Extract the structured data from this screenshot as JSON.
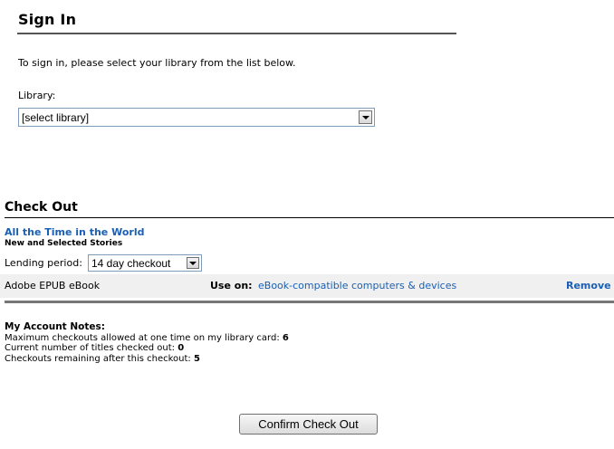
{
  "sign_in": {
    "title": "Sign In",
    "instructions": "To sign in, please select your library from the list below.",
    "library_label": "Library:",
    "library_select_value": "[select library]"
  },
  "checkout": {
    "title": "Check Out",
    "book_title": "All the Time in the World",
    "book_subtitle": "New and Selected Stories",
    "lending_label": "Lending period:",
    "lending_value": "14 day checkout",
    "format": "Adobe EPUB eBook",
    "use_on_label": "Use on:",
    "use_on_link": "eBook-compatible computers & devices",
    "remove_label": "Remove"
  },
  "account_notes": {
    "title": "My Account Notes:",
    "max_label": "Maximum checkouts allowed at one time on my library card:",
    "max_value": "6",
    "current_label": "Current number of titles checked out:",
    "current_value": "0",
    "remaining_label": "Checkouts remaining after this checkout:",
    "remaining_value": "5"
  },
  "confirm_button": "Confirm Check Out",
  "icons": {
    "dropdown": "chevron-down-icon"
  },
  "colors": {
    "link": "#1a5fb4",
    "format_row_bg": "#f0f0f0"
  }
}
